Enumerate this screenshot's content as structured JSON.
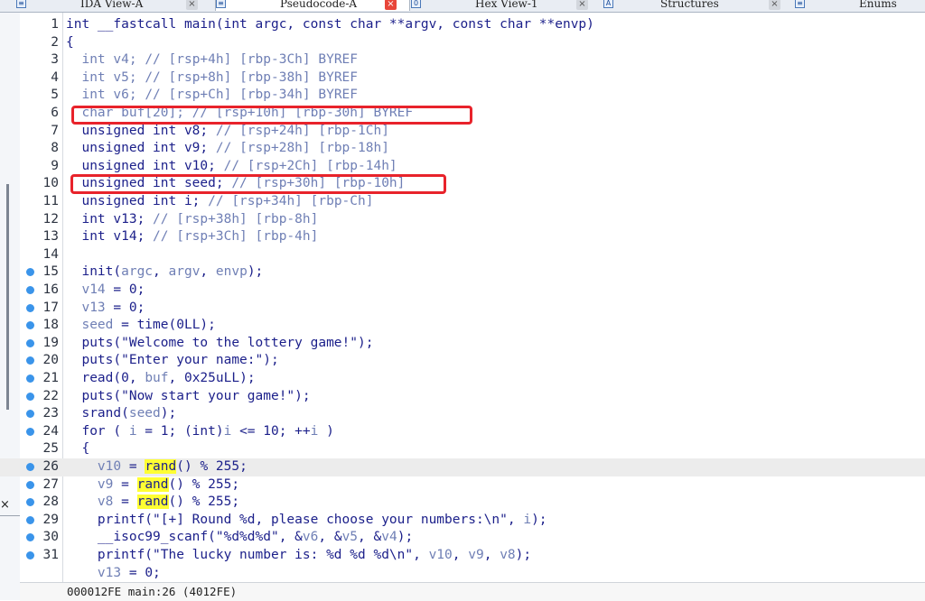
{
  "tabs": [
    {
      "label": "IDA View-A",
      "icon": "ida-view-icon",
      "close": "×",
      "close_style": "grey"
    },
    {
      "label": "Pseudocode-A",
      "icon": "pseudocode-icon",
      "close": "×",
      "close_style": "red"
    },
    {
      "label": "Hex View-1",
      "icon": "hex-view-icon",
      "close": "×",
      "close_style": "grey"
    },
    {
      "label": "Structures",
      "icon": "structures-icon",
      "close": "×",
      "close_style": "grey"
    },
    {
      "label": "Enums",
      "icon": "enums-icon",
      "close": "",
      "close_style": "grey"
    }
  ],
  "left_panel": {
    "close": "×"
  },
  "code": {
    "highlighted_line": 26,
    "lines": [
      {
        "n": "1",
        "dot": false,
        "segs": [
          [
            "int __fastcall main(int argc, const char **argv, const char **envp)",
            ""
          ]
        ]
      },
      {
        "n": "2",
        "dot": false,
        "segs": [
          [
            "{",
            ""
          ]
        ]
      },
      {
        "n": "3",
        "dot": false,
        "segs": [
          [
            "  int v4; ",
            "var"
          ],
          [
            "// [rsp+4h] [rbp-3Ch] BYREF",
            "cm"
          ]
        ]
      },
      {
        "n": "4",
        "dot": false,
        "segs": [
          [
            "  int v5; ",
            "var"
          ],
          [
            "// [rsp+8h] [rbp-38h] BYREF",
            "cm"
          ]
        ]
      },
      {
        "n": "5",
        "dot": false,
        "segs": [
          [
            "  int v6; ",
            "var"
          ],
          [
            "// [rsp+Ch] [rbp-34h] BYREF",
            "cm"
          ]
        ]
      },
      {
        "n": "6",
        "dot": false,
        "segs": [
          [
            "  char buf[20]; ",
            "var"
          ],
          [
            "// [rsp+10h] [rbp-30h] BYREF",
            "cm"
          ]
        ]
      },
      {
        "n": "7",
        "dot": false,
        "segs": [
          [
            "  unsigned int v8; ",
            ""
          ],
          [
            "// [rsp+24h] [rbp-1Ch]",
            "cm"
          ]
        ]
      },
      {
        "n": "8",
        "dot": false,
        "segs": [
          [
            "  unsigned int v9; ",
            ""
          ],
          [
            "// [rsp+28h] [rbp-18h]",
            "cm"
          ]
        ]
      },
      {
        "n": "9",
        "dot": false,
        "segs": [
          [
            "  unsigned int v10; ",
            ""
          ],
          [
            "// [rsp+2Ch] [rbp-14h]",
            "cm"
          ]
        ]
      },
      {
        "n": "10",
        "dot": false,
        "segs": [
          [
            "  unsigned int seed; ",
            ""
          ],
          [
            "// [rsp+30h] [rbp-10h]",
            "cm"
          ]
        ]
      },
      {
        "n": "11",
        "dot": false,
        "segs": [
          [
            "  unsigned int i; ",
            ""
          ],
          [
            "// [rsp+34h] [rbp-Ch]",
            "cm"
          ]
        ]
      },
      {
        "n": "12",
        "dot": false,
        "segs": [
          [
            "  int v13; ",
            ""
          ],
          [
            "// [rsp+38h] [rbp-8h]",
            "cm"
          ]
        ]
      },
      {
        "n": "13",
        "dot": false,
        "segs": [
          [
            "  int v14; ",
            ""
          ],
          [
            "// [rsp+3Ch] [rbp-4h]",
            "cm"
          ]
        ]
      },
      {
        "n": "14",
        "dot": false,
        "segs": [
          [
            "",
            ""
          ]
        ]
      },
      {
        "n": "15",
        "dot": true,
        "segs": [
          [
            "  init(",
            ""
          ],
          [
            "argc",
            "var"
          ],
          [
            ", ",
            ""
          ],
          [
            "argv",
            "var"
          ],
          [
            ", ",
            ""
          ],
          [
            "envp",
            "var"
          ],
          [
            ");",
            ""
          ]
        ]
      },
      {
        "n": "16",
        "dot": true,
        "segs": [
          [
            "  ",
            ""
          ],
          [
            "v14",
            "var"
          ],
          [
            " = 0;",
            ""
          ]
        ]
      },
      {
        "n": "17",
        "dot": true,
        "segs": [
          [
            "  ",
            ""
          ],
          [
            "v13",
            "var"
          ],
          [
            " = 0;",
            ""
          ]
        ]
      },
      {
        "n": "18",
        "dot": true,
        "segs": [
          [
            "  ",
            ""
          ],
          [
            "seed",
            "var"
          ],
          [
            " = time(0LL);",
            ""
          ]
        ]
      },
      {
        "n": "19",
        "dot": true,
        "segs": [
          [
            "  puts(\"Welcome to the lottery game!\");",
            ""
          ]
        ]
      },
      {
        "n": "20",
        "dot": true,
        "segs": [
          [
            "  puts(\"Enter your name:\");",
            ""
          ]
        ]
      },
      {
        "n": "21",
        "dot": true,
        "segs": [
          [
            "  read(0, ",
            ""
          ],
          [
            "buf",
            "var"
          ],
          [
            ", 0x25uLL);",
            ""
          ]
        ]
      },
      {
        "n": "22",
        "dot": true,
        "segs": [
          [
            "  puts(\"Now start your game!\");",
            ""
          ]
        ]
      },
      {
        "n": "23",
        "dot": true,
        "segs": [
          [
            "  srand(",
            ""
          ],
          [
            "seed",
            "var"
          ],
          [
            ");",
            ""
          ]
        ]
      },
      {
        "n": "24",
        "dot": true,
        "segs": [
          [
            "  for ( ",
            ""
          ],
          [
            "i",
            "var"
          ],
          [
            " = 1; (int)",
            ""
          ],
          [
            "i",
            "var"
          ],
          [
            " <= 10; ++",
            ""
          ],
          [
            "i",
            "var"
          ],
          [
            " )",
            ""
          ]
        ]
      },
      {
        "n": "25",
        "dot": false,
        "segs": [
          [
            "  {",
            ""
          ]
        ]
      },
      {
        "n": "26",
        "dot": true,
        "segs": [
          [
            "    ",
            ""
          ],
          [
            "v10",
            "var"
          ],
          [
            " = ",
            ""
          ],
          [
            "rand",
            "y"
          ],
          [
            "() % 255;",
            ""
          ]
        ]
      },
      {
        "n": "27",
        "dot": true,
        "segs": [
          [
            "    ",
            ""
          ],
          [
            "v9",
            "var"
          ],
          [
            " = ",
            ""
          ],
          [
            "rand",
            "y"
          ],
          [
            "() % 255;",
            ""
          ]
        ]
      },
      {
        "n": "28",
        "dot": true,
        "segs": [
          [
            "    ",
            ""
          ],
          [
            "v8",
            "var"
          ],
          [
            " = ",
            ""
          ],
          [
            "rand",
            "y"
          ],
          [
            "() % 255;",
            ""
          ]
        ]
      },
      {
        "n": "29",
        "dot": true,
        "segs": [
          [
            "    printf(\"[+] Round %d, please choose your numbers:\\n\", ",
            ""
          ],
          [
            "i",
            "var"
          ],
          [
            ");",
            ""
          ]
        ]
      },
      {
        "n": "30",
        "dot": true,
        "segs": [
          [
            "    __isoc99_scanf(\"%d%d%d\", &",
            ""
          ],
          [
            "v6",
            "var"
          ],
          [
            ", &",
            ""
          ],
          [
            "v5",
            "var"
          ],
          [
            ", &",
            ""
          ],
          [
            "v4",
            "var"
          ],
          [
            ");",
            ""
          ]
        ]
      },
      {
        "n": "31",
        "dot": true,
        "segs": [
          [
            "    printf(\"The lucky number is: %d %d %d\\n\", ",
            ""
          ],
          [
            "v10",
            "var"
          ],
          [
            ", ",
            ""
          ],
          [
            "v9",
            "var"
          ],
          [
            ", ",
            ""
          ],
          [
            "v8",
            "var"
          ],
          [
            ");",
            ""
          ]
        ]
      },
      {
        "n": "",
        "dot": false,
        "segs": [
          [
            "    ",
            ""
          ],
          [
            "v13",
            "var"
          ],
          [
            " = 0;",
            ""
          ]
        ]
      }
    ]
  },
  "annotations": [
    {
      "label": "buf-declaration-box",
      "line": 6
    },
    {
      "label": "seed-declaration-box",
      "line": 10
    }
  ],
  "status": {
    "text": "000012FE main:26 (4012FE)"
  },
  "colors": {
    "code": "#1b1f8a",
    "comment": "#6f7fb5",
    "highlight": "#ffff33",
    "annotation": "#e8232b",
    "breakpoint_dot": "#3a94ea"
  }
}
